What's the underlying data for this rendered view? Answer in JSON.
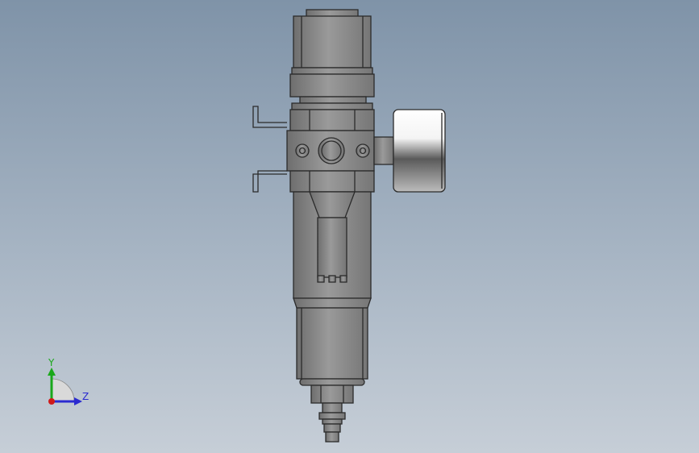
{
  "viewport": {
    "background_top": "#7f93a8",
    "background_bottom": "#c6ced7"
  },
  "model": {
    "description_icon": "filter-regulator-with-gauge-icon",
    "body_color": "#8a8a8a",
    "edge_color": "#2b2b2b",
    "gauge_face_color": "#f2f2f2"
  },
  "triad": {
    "y_label": "Y",
    "z_label": "Z",
    "y_color": "#1aa81a",
    "z_color": "#2a2ad0",
    "x_color": "#d01a1a"
  }
}
